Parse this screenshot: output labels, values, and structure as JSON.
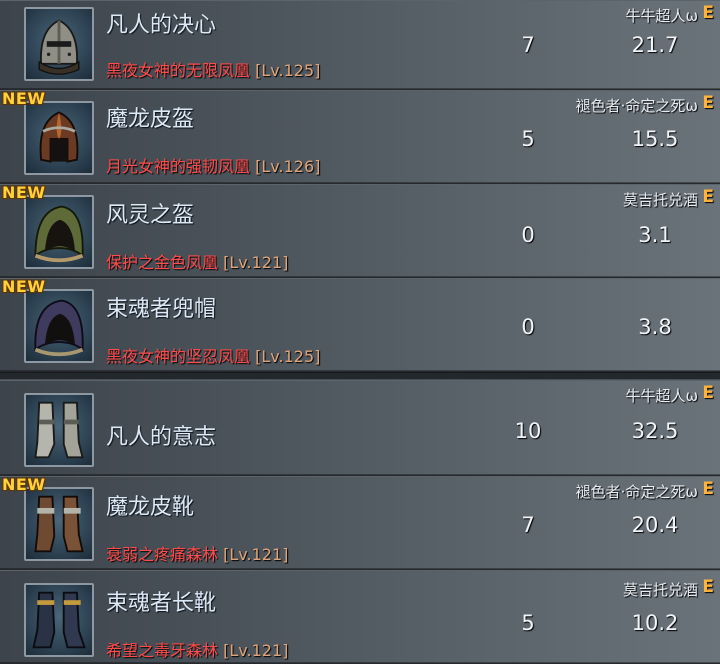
{
  "rows": [
    {
      "new": "",
      "icon": "iron-helmet-icon",
      "name": "凡人的决心",
      "source": "黑夜女神的无限凤凰",
      "level": "[Lv.125]",
      "owner": "牛牛超人ω",
      "grade": "E",
      "stat_a": "7",
      "stat_b": "21.7"
    },
    {
      "new": "NEW",
      "icon": "dragon-leather-helmet-icon",
      "name": "魔龙皮盔",
      "source": "月光女神的强韧凤凰",
      "level": "[Lv.126]",
      "owner": "褪色者·命定之死ω",
      "grade": "E",
      "stat_a": "5",
      "stat_b": "15.5"
    },
    {
      "new": "NEW",
      "icon": "wind-spirit-hood-icon",
      "name": "风灵之盔",
      "source": "保护之金色凤凰",
      "level": "[Lv.121]",
      "owner": "莫吉托兑酒",
      "grade": "E",
      "stat_a": "0",
      "stat_b": "3.1"
    },
    {
      "new": "NEW",
      "icon": "soul-binder-hood-icon",
      "name": "束魂者兜帽",
      "source": "黑夜女神的坚忍凤凰",
      "level": "[Lv.125]",
      "owner": "",
      "grade": "",
      "stat_a": "0",
      "stat_b": "3.8"
    },
    {
      "new": "",
      "icon": "iron-greaves-icon",
      "name": "凡人的意志",
      "source": "",
      "level": "",
      "owner": "牛牛超人ω",
      "grade": "E",
      "stat_a": "10",
      "stat_b": "32.5"
    },
    {
      "new": "NEW",
      "icon": "dragon-leather-boots-icon",
      "name": "魔龙皮靴",
      "source": "衰弱之疼痛森林",
      "level": "[Lv.121]",
      "owner": "褪色者·命定之死ω",
      "grade": "E",
      "stat_a": "7",
      "stat_b": "20.4"
    },
    {
      "new": "",
      "icon": "soul-binder-boots-icon",
      "name": "束魂者长靴",
      "source": "希望之毒牙森林",
      "level": "[Lv.121]",
      "owner": "莫吉托兑酒",
      "grade": "E",
      "stat_a": "5",
      "stat_b": "10.2"
    }
  ]
}
